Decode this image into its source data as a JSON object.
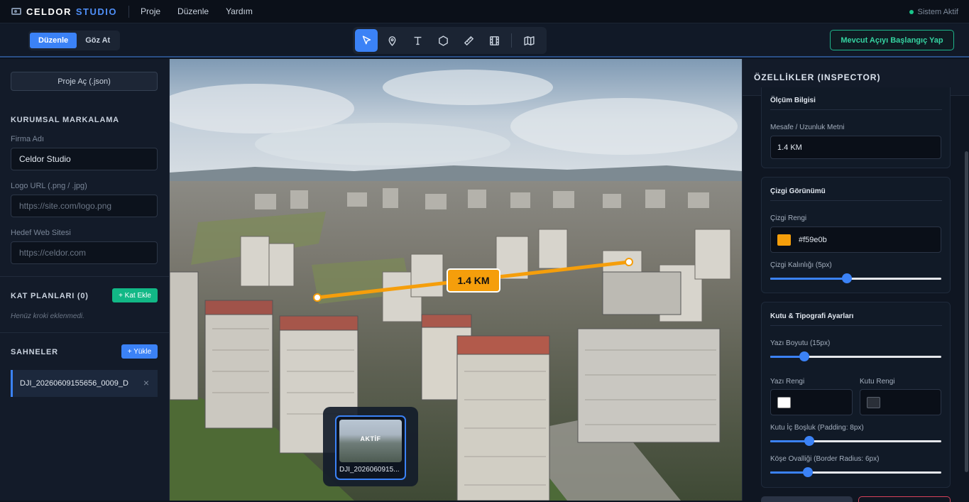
{
  "app": {
    "brand_primary": "CELDOR",
    "brand_secondary": "STUDIO",
    "menu": [
      "Proje",
      "Düzenle",
      "Yardım"
    ],
    "status": "Sistem Aktif"
  },
  "toolbar": {
    "modes": [
      "Düzenle",
      "Göz At"
    ],
    "active_mode": "Düzenle",
    "tools": [
      "select-cursor-icon",
      "map-pin-icon",
      "text-icon",
      "polygon-icon",
      "ruler-icon",
      "film-icon",
      "map-icon"
    ],
    "active_tool": "select-cursor-icon",
    "cta_label": "Mevcut Açıyı Başlangıç Yap"
  },
  "sidebar": {
    "open_project_label": "Proje Aç (.json)",
    "branding_title": "KURUMSAL MARKALAMA",
    "company_label": "Firma Adı",
    "company_value": "Celdor Studio",
    "logo_label": "Logo URL (.png / .jpg)",
    "logo_placeholder": "https://site.com/logo.png",
    "website_label": "Hedef Web Sitesi",
    "website_placeholder": "https://celdor.com",
    "floorplans_title": "KAT PLANLARI (0)",
    "add_floor_label": "+ Kat Ekle",
    "floorplans_empty": "Henüz kroki eklenmedi.",
    "scenes_title": "SAHNELER",
    "upload_label": "+ Yükle",
    "scenes": [
      "DJI_20260609155656_0009_D"
    ],
    "close_glyph": "×",
    "collapse_glyph": "◀"
  },
  "viewport": {
    "measure_text": "1.4 KM",
    "active_badge": "AKTİF",
    "thumb_name": "DJI_2026060915..."
  },
  "inspector": {
    "title": "ÖZELLİKLER (INSPECTOR)",
    "measure_section": "Ölçüm Bilgisi",
    "distance_label": "Mesafe / Uzunluk Metni",
    "distance_value": "1.4 KM",
    "line_section": "Çizgi Görünümü",
    "line_color_label": "Çizgi Rengi",
    "line_color_value": "#f59e0b",
    "line_width_label": "Çizgi Kalınlığı (5px)",
    "line_width_level": 0.45,
    "box_section": "Kutu & Tipografi Ayarları",
    "font_size_label": "Yazı Boyutu (15px)",
    "font_size_level": 0.2,
    "text_color_label": "Yazı Rengi",
    "text_color": "#ffffff",
    "box_color_label": "Kutu Rengi",
    "box_color": "#2a2f38",
    "padding_label": "Kutu İç Boşluk (Padding: 8px)",
    "padding_level": 0.23,
    "radius_label": "Köşe Ovalliği (Border Radius: 6px)",
    "radius_level": 0.22
  },
  "colors": {
    "accent": "#3b82f6",
    "success": "#12b886",
    "measure": "#f59e0b"
  }
}
